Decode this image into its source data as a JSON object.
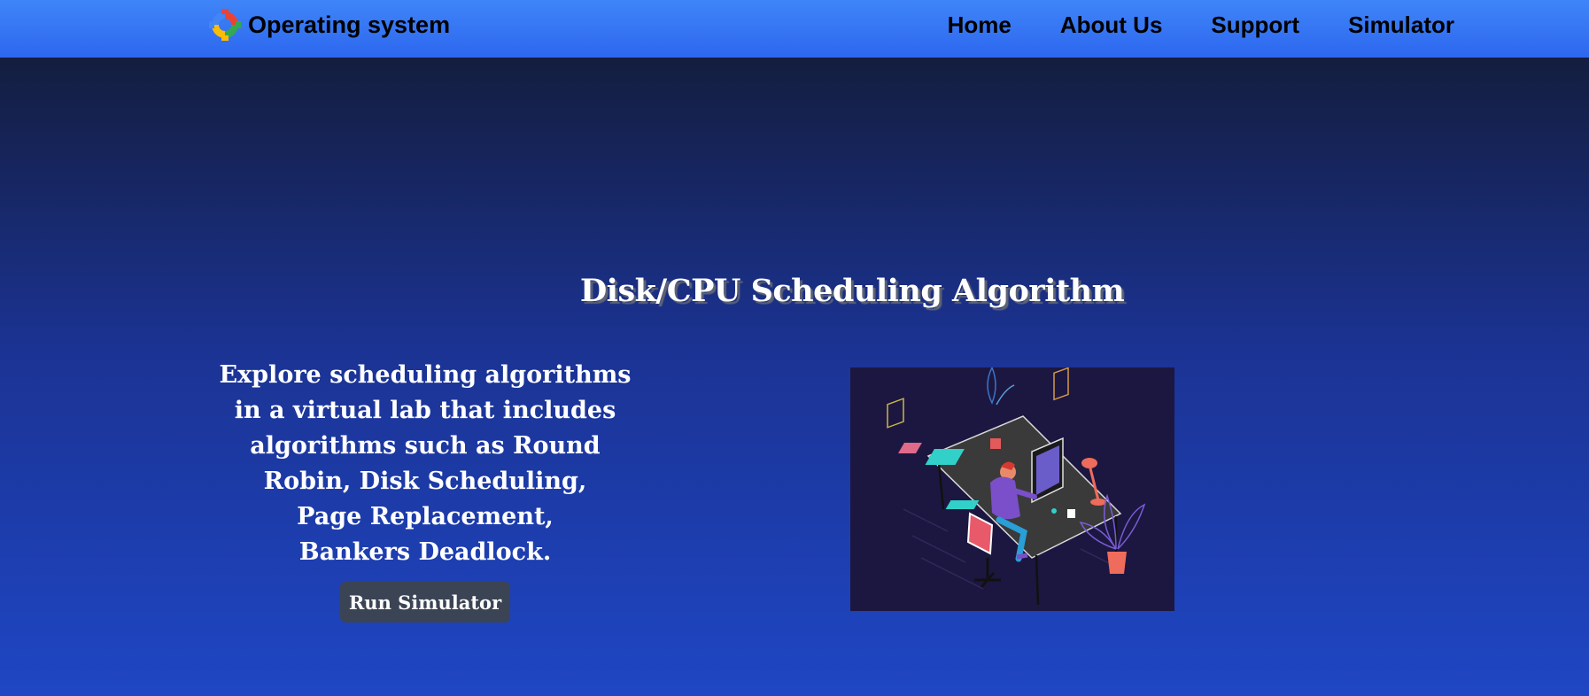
{
  "navbar": {
    "brand_text": "Operating system",
    "links": [
      {
        "label": "Home"
      },
      {
        "label": "About Us"
      },
      {
        "label": "Support"
      },
      {
        "label": "Simulator"
      }
    ]
  },
  "hero": {
    "title": "Disk/CPU Scheduling Algorithm",
    "description_lines": [
      "Explore scheduling algorithms",
      "in a virtual lab that includes",
      "algorithms such as Round",
      "Robin, Disk Scheduling,",
      "Page Replacement,",
      "Bankers Deadlock."
    ],
    "button_label": "Run Simulator"
  },
  "colors": {
    "navbar": "#3f85f8",
    "button": "#3b4454",
    "text": "#ffffff"
  },
  "icons": {
    "logo": "os-logo-icon",
    "illustration": "developer-at-desk-illustration"
  }
}
